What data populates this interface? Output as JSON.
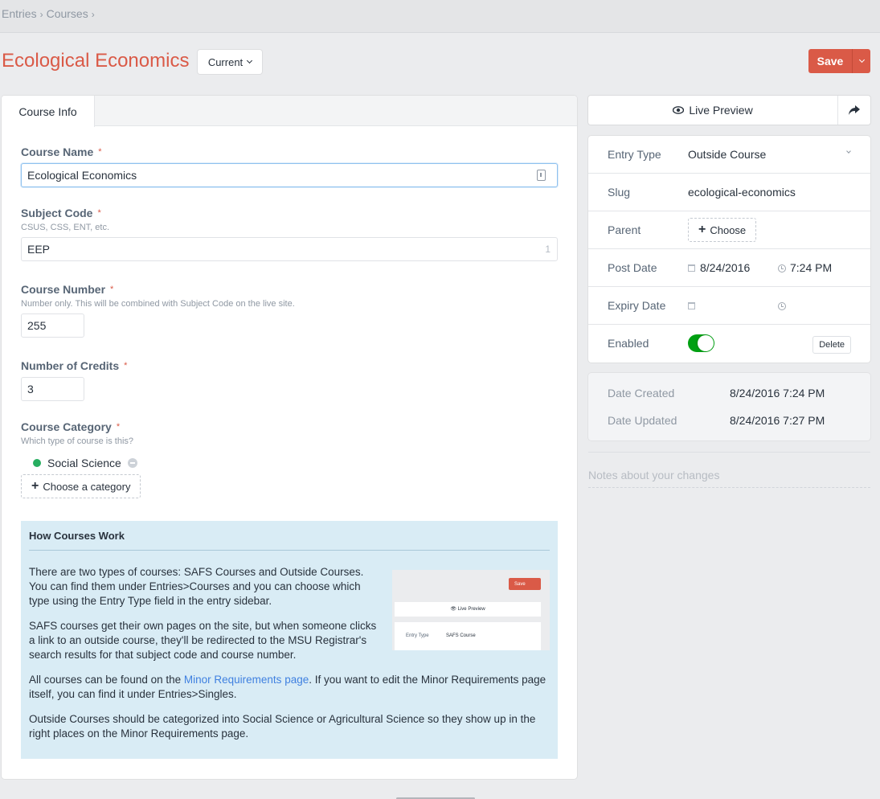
{
  "breadcrumb": [
    {
      "label": "Entries"
    },
    {
      "label": "Courses"
    }
  ],
  "header": {
    "title": "Ecological Economics",
    "revision_label": "Current",
    "save_label": "Save"
  },
  "tabs": [
    {
      "label": "Course Info"
    }
  ],
  "fields": {
    "course_name": {
      "label": "Course Name",
      "value": "Ecological Economics"
    },
    "subject_code": {
      "label": "Subject Code",
      "instructions": "CSUS, CSS, ENT, etc.",
      "value": "EEP",
      "counter": "1"
    },
    "course_number": {
      "label": "Course Number",
      "instructions": "Number only. This will be combined with Subject Code on the live site.",
      "value": "255"
    },
    "credits": {
      "label": "Number of Credits",
      "value": "3"
    },
    "category": {
      "label": "Course Category",
      "instructions": "Which type of course is this?",
      "selected": "Social Science",
      "add_label": "Choose a category"
    }
  },
  "required_marker": "*",
  "info_box": {
    "title": "How Courses Work",
    "p1": "There are two types of courses: SAFS Courses and Outside Courses. You can find them under Entries>Courses and you can choose which type using the Entry Type field in the entry sidebar.",
    "p2": "SAFS courses get their own pages on the site, but when someone clicks a link to an outside course, they'll be redirected to the MSU Registrar's search results for that subject code and course number.",
    "p3_before": "All courses can be found on the ",
    "p3_link": "Minor Requirements page",
    "p3_after": ". If you want to edit the Minor Requirements page itself, you can find it under Entries>Singles.",
    "p4": "Outside Courses should be categorized into Social Science or Agricultural Science so they show up in the right places on the Minor Requirements page.",
    "image": {
      "save_label": "Save",
      "live_preview_label": "Live Preview",
      "entry_type_label": "Entry Type",
      "entry_type_value": "SAFS Course"
    }
  },
  "sidebar": {
    "live_preview_label": "Live Preview",
    "entry_type": {
      "label": "Entry Type",
      "value": "Outside Course"
    },
    "slug": {
      "label": "Slug",
      "value": "ecological-economics"
    },
    "parent": {
      "label": "Parent",
      "button": "Choose"
    },
    "post_date": {
      "label": "Post Date",
      "date": "8/24/2016",
      "time": "7:24 PM"
    },
    "expiry_date": {
      "label": "Expiry Date",
      "date": "",
      "time": ""
    },
    "enabled": {
      "label": "Enabled",
      "value": true
    },
    "delete_label": "Delete",
    "date_created": {
      "label": "Date Created",
      "value": "8/24/2016 7:24 PM"
    },
    "date_updated": {
      "label": "Date Updated",
      "value": "8/24/2016 7:27 PM"
    },
    "notes_placeholder": "Notes about your changes"
  },
  "colors": {
    "accent": "#da5a47",
    "link": "#3f80e0",
    "enabled_toggle": "#00a012",
    "category_dot": "#27ae60",
    "info_bg": "#d9ecf5"
  }
}
